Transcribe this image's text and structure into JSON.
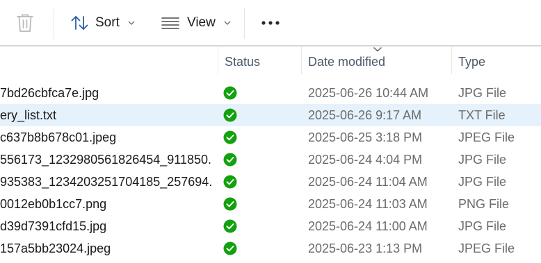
{
  "toolbar": {
    "sort_label": "Sort",
    "view_label": "View"
  },
  "columns": {
    "status": "Status",
    "date_modified": "Date modified",
    "type": "Type"
  },
  "files": [
    {
      "name": "7bd26cbfca7e.jpg",
      "date": "2025-06-26 10:44 AM",
      "type": "JPG File",
      "status": "synced"
    },
    {
      "name": "ery_list.txt",
      "date": "2025-06-26 9:17 AM",
      "type": "TXT File",
      "status": "synced",
      "selected": true
    },
    {
      "name": "c637b8b678c01.jpeg",
      "date": "2025-06-25 3:18 PM",
      "type": "JPEG File",
      "status": "synced"
    },
    {
      "name": "556173_1232980561826454_911850...",
      "date": "2025-06-24 4:04 PM",
      "type": "JPG File",
      "status": "synced"
    },
    {
      "name": "935383_1234203251704185_257694...",
      "date": "2025-06-24 11:04 AM",
      "type": "JPG File",
      "status": "synced"
    },
    {
      "name": "0012eb0b1cc7.png",
      "date": "2025-06-24 11:03 AM",
      "type": "PNG File",
      "status": "synced"
    },
    {
      "name": "d39d7391cfd15.jpg",
      "date": "2025-06-24 11:00 AM",
      "type": "JPG File",
      "status": "synced"
    },
    {
      "name": "157a5bb23024.jpeg",
      "date": "2025-06-23 1:13 PM",
      "type": "JPEG File",
      "status": "synced"
    }
  ],
  "colors": {
    "accent_blue": "#0f6cbd",
    "status_green": "#13a10e",
    "selected_row": "#e5f1fb"
  },
  "icons": {
    "delete": "trash-icon",
    "sort": "sort-arrows-icon",
    "view": "view-lines-icon",
    "more": "more-icon",
    "status": "check-circle-icon"
  }
}
